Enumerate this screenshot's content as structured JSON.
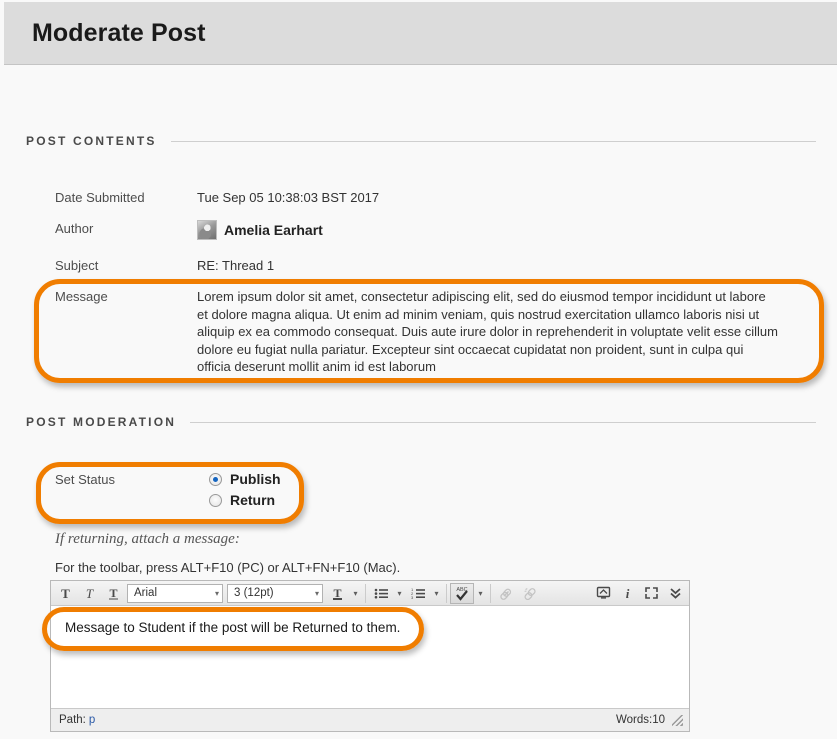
{
  "header": {
    "title": "Moderate Post"
  },
  "sections": {
    "contents": "POST CONTENTS",
    "moderation": "POST MODERATION"
  },
  "post": {
    "date_label": "Date Submitted",
    "date_value": "Tue Sep 05 10:38:03 BST 2017",
    "author_label": "Author",
    "author_value": "Amelia Earhart",
    "subject_label": "Subject",
    "subject_value": "RE: Thread 1",
    "message_label": "Message",
    "message_value": "Lorem ipsum dolor sit amet, consectetur adipiscing elit, sed do eiusmod tempor incididunt ut labore et dolore magna aliqua. Ut enim ad minim veniam, quis nostrud exercitation ullamco laboris nisi ut aliquip ex ea commodo consequat. Duis aute irure dolor in reprehenderit in voluptate velit esse cillum dolore eu fugiat nulla pariatur. Excepteur sint occaecat cupidatat non proident, sunt in culpa qui officia deserunt mollit anim id est laborum"
  },
  "moderation": {
    "set_status_label": "Set Status",
    "options": [
      {
        "label": "Publish",
        "checked": true
      },
      {
        "label": "Return",
        "checked": false
      }
    ],
    "attach_note": "If returning, attach a message:",
    "toolbar_hint": "For the toolbar, press ALT+F10 (PC) or ALT+FN+F10 (Mac)."
  },
  "editor": {
    "font_family": "Arial",
    "font_size": "3 (12pt)",
    "content": "Message to Student if the post will be Returned to them.",
    "path_label": "Path:",
    "path_value": "p",
    "words_label": "Words:10",
    "toolbar_icons": [
      "bold-icon",
      "italic-icon",
      "underline-icon",
      "font-family-select",
      "font-size-select",
      "text-color-icon",
      "bullet-list-icon",
      "numbered-list-icon",
      "spellcheck-icon",
      "insert-link-icon",
      "remove-link-icon",
      "preview-icon",
      "info-icon",
      "fullscreen-icon",
      "collapse-toolbar-icon"
    ]
  },
  "colors": {
    "highlight": "#f07d00",
    "header_bg": "#dcdcdc",
    "page_bg": "#f9f9f9",
    "radio_selected": "#1565c0"
  }
}
